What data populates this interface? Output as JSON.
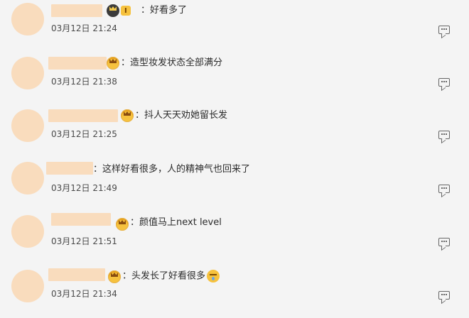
{
  "comments": [
    {
      "text": "好看多了",
      "time": "03月12日 21:24",
      "badge_level": "I"
    },
    {
      "text": "造型妆发状态全部满分",
      "time": "03月12日 21:38"
    },
    {
      "text": "抖人天天劝她留长发",
      "time": "03月12日 21:25"
    },
    {
      "text": "这样好看很多，人的精神气也回来了",
      "time": "03月12日 21:49"
    },
    {
      "text": "颜值马上next level",
      "time": "03月12日 21:51"
    },
    {
      "text": "头发长了好看很多",
      "time": "03月12日 21:34"
    }
  ],
  "icons": {
    "badge": "crown-icon",
    "reply": "comment-reply-icon",
    "emoji": "emoji-icon"
  },
  "colors": {
    "background": "#f4f4f4",
    "redaction": "#f9dcbd",
    "badge": "#f6c23e"
  }
}
